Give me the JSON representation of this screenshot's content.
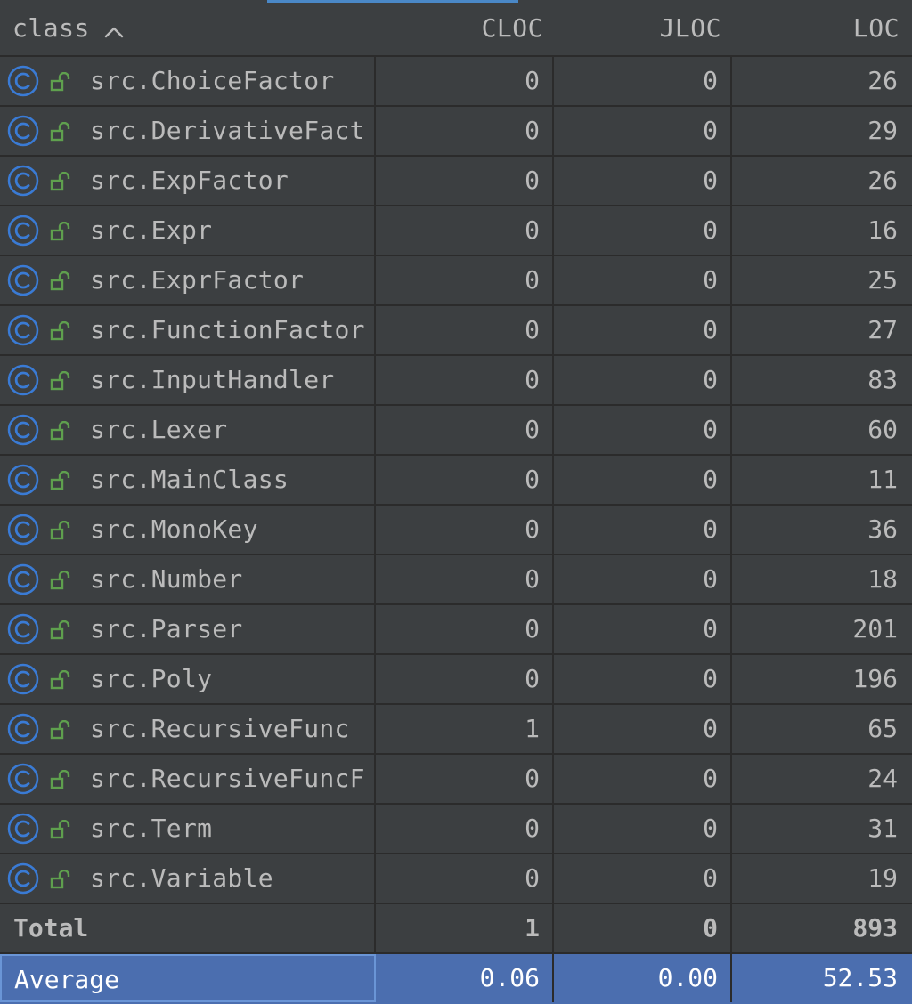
{
  "header": {
    "class_label": "class",
    "cloc_label": "CLOC",
    "jloc_label": "JLOC",
    "loc_label": "LOC"
  },
  "rows": [
    {
      "name": "src.ChoiceFactor",
      "cloc": "0",
      "jloc": "0",
      "loc": "26"
    },
    {
      "name": "src.DerivativeFact",
      "cloc": "0",
      "jloc": "0",
      "loc": "29"
    },
    {
      "name": "src.ExpFactor",
      "cloc": "0",
      "jloc": "0",
      "loc": "26"
    },
    {
      "name": "src.Expr",
      "cloc": "0",
      "jloc": "0",
      "loc": "16"
    },
    {
      "name": "src.ExprFactor",
      "cloc": "0",
      "jloc": "0",
      "loc": "25"
    },
    {
      "name": "src.FunctionFactor",
      "cloc": "0",
      "jloc": "0",
      "loc": "27"
    },
    {
      "name": "src.InputHandler",
      "cloc": "0",
      "jloc": "0",
      "loc": "83"
    },
    {
      "name": "src.Lexer",
      "cloc": "0",
      "jloc": "0",
      "loc": "60"
    },
    {
      "name": "src.MainClass",
      "cloc": "0",
      "jloc": "0",
      "loc": "11"
    },
    {
      "name": "src.MonoKey",
      "cloc": "0",
      "jloc": "0",
      "loc": "36"
    },
    {
      "name": "src.Number",
      "cloc": "0",
      "jloc": "0",
      "loc": "18"
    },
    {
      "name": "src.Parser",
      "cloc": "0",
      "jloc": "0",
      "loc": "201"
    },
    {
      "name": "src.Poly",
      "cloc": "0",
      "jloc": "0",
      "loc": "196"
    },
    {
      "name": "src.RecursiveFunc",
      "cloc": "1",
      "jloc": "0",
      "loc": "65"
    },
    {
      "name": "src.RecursiveFuncF",
      "cloc": "0",
      "jloc": "0",
      "loc": "24"
    },
    {
      "name": "src.Term",
      "cloc": "0",
      "jloc": "0",
      "loc": "31"
    },
    {
      "name": "src.Variable",
      "cloc": "0",
      "jloc": "0",
      "loc": "19"
    }
  ],
  "total": {
    "label": "Total",
    "cloc": "1",
    "jloc": "0",
    "loc": "893"
  },
  "average": {
    "label": "Average",
    "cloc": "0.06",
    "jloc": "0.00",
    "loc": "52.53"
  },
  "icons": {
    "row_type": "class-icon",
    "row_access": "public-lock-icon",
    "sort": "sort-ascending-icon"
  },
  "colors": {
    "background": "#3c3f41",
    "grid": "#2b2b2b",
    "text": "#bbbbbb",
    "class_icon": "#3a7bd5",
    "lock_icon": "#5fa04e",
    "selection": "#4b6eaf",
    "selection_border": "#6a95d6"
  }
}
